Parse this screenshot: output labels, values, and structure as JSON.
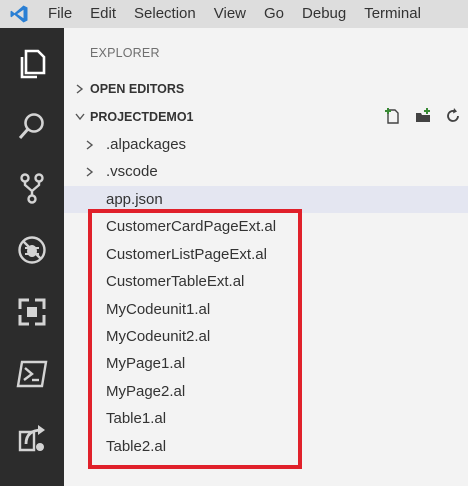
{
  "menu": {
    "logo": "vscode-logo-icon",
    "items": [
      "File",
      "Edit",
      "Selection",
      "View",
      "Go",
      "Debug",
      "Terminal"
    ]
  },
  "activity_bar": {
    "icons": [
      "explorer-icon",
      "search-icon",
      "source-control-icon",
      "debug-icon",
      "extensions-icon",
      "powershell-icon",
      "remote-icon"
    ]
  },
  "sidebar": {
    "title": "EXPLORER",
    "open_editors": {
      "label": "OPEN EDITORS",
      "expanded": false
    },
    "project": {
      "label": "PROJECTDEMO1",
      "expanded": true,
      "actions": [
        "new-file-icon",
        "new-folder-icon",
        "refresh-icon"
      ],
      "folders": [
        ".alpackages",
        ".vscode"
      ],
      "files": [
        "app.json",
        "CustomerCardPageExt.al",
        "CustomerListPageExt.al",
        "CustomerTableExt.al",
        "MyCodeunit1.al",
        "MyCodeunit2.al",
        "MyPage1.al",
        "MyPage2.al",
        "Table1.al",
        "Table2.al"
      ],
      "selected_file": "app.json"
    }
  },
  "colors": {
    "menu_bg": "#dddddd",
    "activity_bg": "#2c2c2c",
    "sidebar_bg": "#f3f3f3",
    "selected_bg": "#e4e6f1",
    "highlight_border": "#e0202a",
    "logo_blue": "#2a7fd4"
  }
}
